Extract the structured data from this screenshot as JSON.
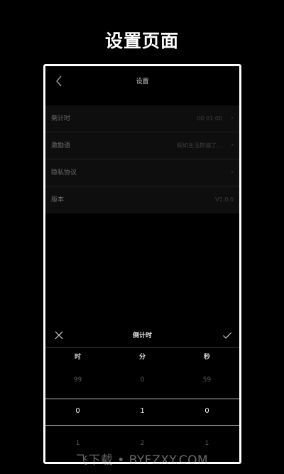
{
  "promo": {
    "title": "设置页面"
  },
  "navbar": {
    "title": "设置",
    "back_icon": "chevron-left-icon"
  },
  "settings": [
    {
      "label": "倒计时",
      "value": "00:01:00",
      "has_chevron": true
    },
    {
      "label": "激励语",
      "value": "假如生活欺骗了…",
      "has_chevron": true
    },
    {
      "label": "隐私协议",
      "value": "",
      "has_chevron": true
    },
    {
      "label": "版本",
      "value": "V1.0.0",
      "has_chevron": false
    }
  ],
  "picker": {
    "title": "倒计时",
    "close_icon": "close-icon",
    "confirm_icon": "check-icon",
    "columns": [
      "时",
      "分",
      "秒"
    ],
    "prev_values": [
      "99",
      "0",
      "59"
    ],
    "selected_values": [
      "0",
      "1",
      "0"
    ],
    "next_values": [
      "1",
      "2",
      "1"
    ]
  },
  "watermark": "飞下载 • BYFZXY.COM"
}
